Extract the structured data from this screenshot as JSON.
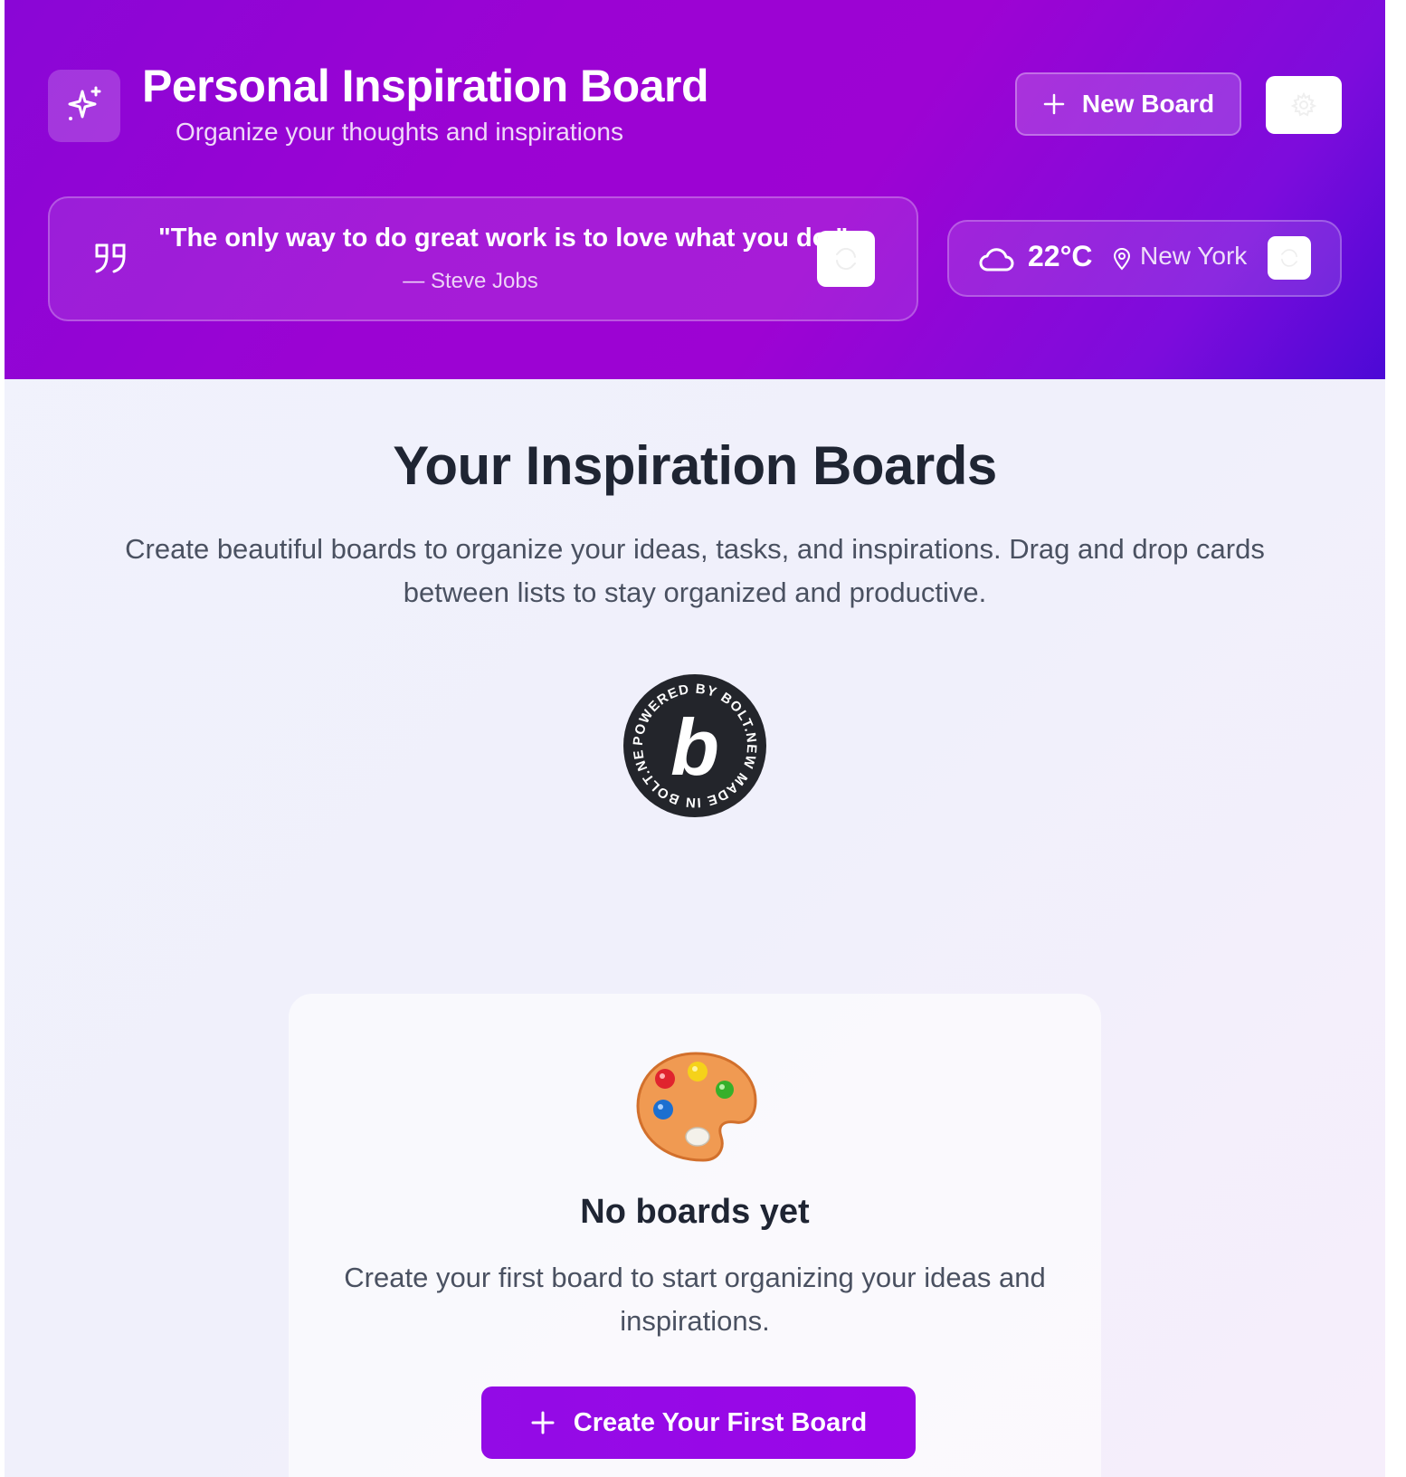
{
  "header": {
    "title": "Personal Inspiration Board",
    "subtitle": "Organize your thoughts and inspirations",
    "new_board_label": "New Board",
    "logo_icon": "sparkles-icon",
    "settings_icon": "gear-icon"
  },
  "quote": {
    "text": "\"The only way to do great work is to love what you do.\"",
    "author": "— Steve Jobs",
    "icon": "quote-icon",
    "refresh_icon": "refresh-icon"
  },
  "weather": {
    "temperature": "22°C",
    "location": "New York",
    "icon": "cloud-icon",
    "location_icon": "map-pin-icon",
    "refresh_icon": "refresh-icon"
  },
  "main": {
    "title": "Your Inspiration Boards",
    "description": "Create beautiful boards to organize your ideas, tasks, and inspirations. Drag and drop cards between lists to stay organized and productive."
  },
  "badge": {
    "ring_text": "POWERED BY BOLT.NEW MADE IN BOLT.NEW",
    "letter": "b"
  },
  "empty_state": {
    "icon": "artist-palette-icon",
    "title": "No boards yet",
    "description": "Create your first board to start organizing your ideas and inspirations.",
    "button_label": "Create Your First Board"
  },
  "colors": {
    "header_start": "#8a06d6",
    "header_end": "#4c09d6",
    "accent_button": "#930be6",
    "heading_text": "#1f2533",
    "body_text": "#4a5161"
  }
}
